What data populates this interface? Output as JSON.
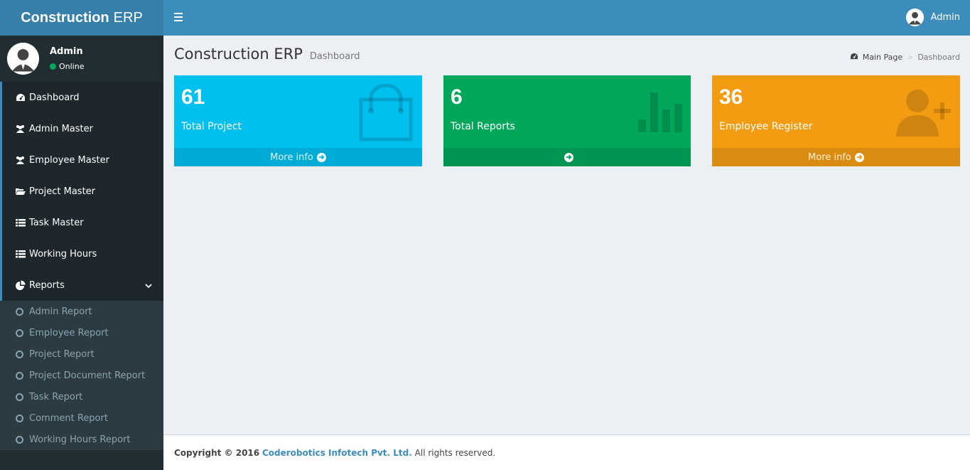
{
  "logo": {
    "bold": "Construction",
    "light": "ERP"
  },
  "navbar": {
    "user_name": "Admin"
  },
  "sidebar": {
    "user": {
      "name": "Admin",
      "status": "Online"
    },
    "items": [
      {
        "label": "Dashboard",
        "icon": "dashboard-icon"
      },
      {
        "label": "Admin Master",
        "icon": "users-icon"
      },
      {
        "label": "Employee Master",
        "icon": "users-icon"
      },
      {
        "label": "Project Master",
        "icon": "folder-open-icon"
      },
      {
        "label": "Task Master",
        "icon": "list-icon"
      },
      {
        "label": "Working Hours",
        "icon": "list-icon"
      },
      {
        "label": "Reports",
        "icon": "pie-chart-icon"
      }
    ],
    "reports_sub": [
      "Admin Report",
      "Employee Report",
      "Project Report",
      "Project Document Report",
      "Task Report",
      "Comment Report",
      "Working Hours Report"
    ]
  },
  "header": {
    "title": "Construction ERP",
    "subtitle": "Dashboard"
  },
  "breadcrumb": {
    "home": "Main Page",
    "current": "Dashboard"
  },
  "boxes": [
    {
      "value": "61",
      "label": "Total Project",
      "footer": "More info",
      "color": "#00c0ef",
      "icon": "shopping-bag-icon"
    },
    {
      "value": "6",
      "label": "Total Reports",
      "footer": "",
      "color": "#00a65a",
      "icon": "bar-chart-icon"
    },
    {
      "value": "36",
      "label": "Employee Register",
      "footer": "More info",
      "color": "#f39c12",
      "icon": "user-plus-icon"
    }
  ],
  "footer": {
    "copyright": "Copyright © 2016",
    "company": "Coderobotics Infotech Pvt. Ltd.",
    "rights": "All rights reserved."
  }
}
